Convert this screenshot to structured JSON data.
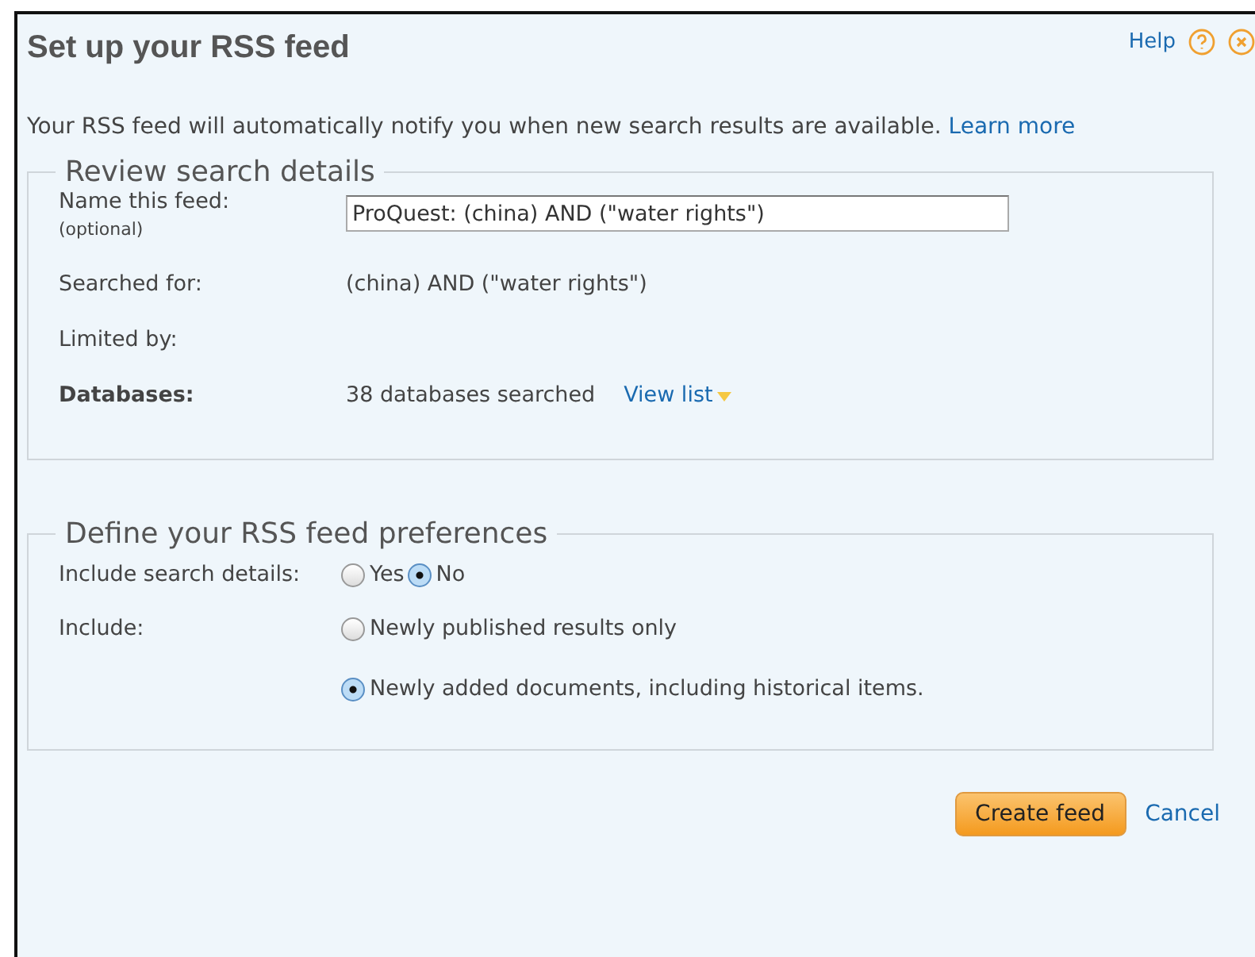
{
  "dialog": {
    "title": "Set up your RSS feed",
    "help": "Help",
    "intro": "Your RSS feed will automatically notify you when new search results are available.",
    "intro_link": "Learn more"
  },
  "review": {
    "legend": "Review search details",
    "name_label": "Name this feed:",
    "name_hint": "(optional)",
    "name_value": "ProQuest: (china) AND (\"water rights\")",
    "rows": [
      {
        "label": "Searched for:",
        "value": "(china) AND (\"water rights\")",
        "bold": false
      },
      {
        "label": "Limited by:",
        "value": "",
        "bold": false
      },
      {
        "label": "Databases:",
        "value": "38 databases searched",
        "link": "View list",
        "bold": true
      }
    ]
  },
  "preferences": {
    "legend": "Define your RSS feed preferences",
    "details_label": "Include search details:",
    "details_options": [
      {
        "label": "Yes",
        "selected": false
      },
      {
        "label": "No",
        "selected": true
      }
    ],
    "include_label": "Include:",
    "include_options": [
      {
        "label": "Newly published results only",
        "selected": false
      },
      {
        "label": "Newly added documents, including historical items.",
        "selected": true
      }
    ]
  },
  "buttons": {
    "primary": "Create feed",
    "cancel": "Cancel"
  }
}
